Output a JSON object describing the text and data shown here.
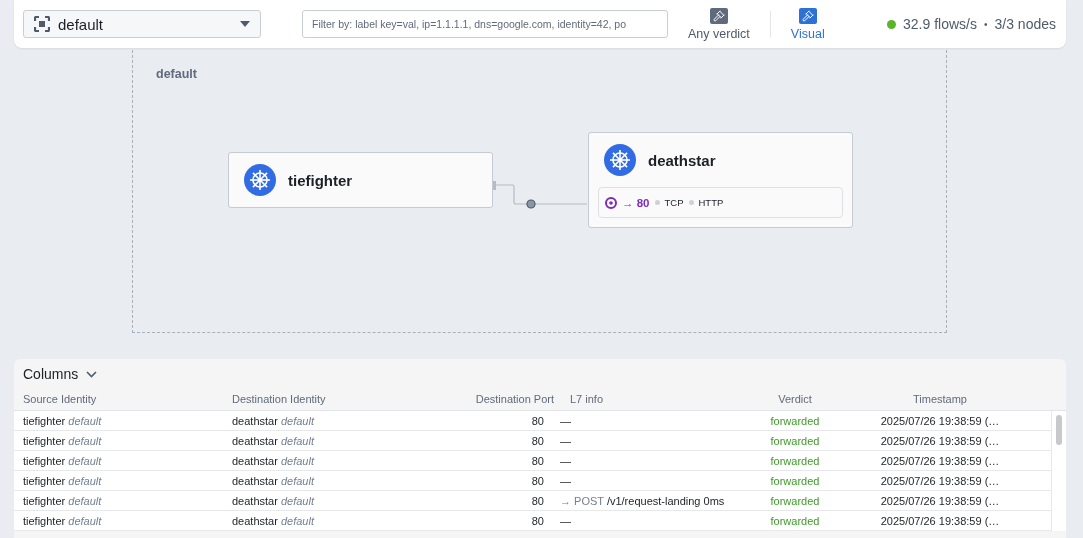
{
  "toolbar": {
    "namespace": "default",
    "filter": {
      "placeholder": "Filter by: label key=val, ip=1.1.1.1, dns=google.com, identity=42, po"
    },
    "view_toggles": [
      {
        "label": "Any verdict",
        "selected": false
      },
      {
        "label": "Visual",
        "selected": true
      }
    ],
    "status": {
      "live": true,
      "flow_rate": "32.9 flows/s",
      "separator": "•",
      "nodes": "3/3 nodes"
    }
  },
  "map": {
    "namespace": "default",
    "services": [
      {
        "name": "tiefighter"
      },
      {
        "name": "deathstar",
        "ports": [
          {
            "arrow": "→",
            "port": "80",
            "protocols": [
              "TCP",
              "HTTP"
            ]
          }
        ]
      }
    ]
  },
  "flows": {
    "columns_button": "Columns",
    "columns": [
      "Source Identity",
      "Destination Identity",
      "Destination Port",
      "L7 info",
      "Verdict",
      "Timestamp"
    ],
    "rows": [
      {
        "source": "tiefighter",
        "source_ns": "default",
        "destination": "deathstar",
        "destination_ns": "default",
        "port": "80",
        "l7": {
          "kind": "none",
          "text": "—"
        },
        "verdict": "forwarded",
        "timestamp": "2025/07/26 19:38:59 (…"
      },
      {
        "source": "tiefighter",
        "source_ns": "default",
        "destination": "deathstar",
        "destination_ns": "default",
        "port": "80",
        "l7": {
          "kind": "none",
          "text": "—"
        },
        "verdict": "forwarded",
        "timestamp": "2025/07/26 19:38:59 (…"
      },
      {
        "source": "tiefighter",
        "source_ns": "default",
        "destination": "deathstar",
        "destination_ns": "default",
        "port": "80",
        "l7": {
          "kind": "none",
          "text": "—"
        },
        "verdict": "forwarded",
        "timestamp": "2025/07/26 19:38:59 (…"
      },
      {
        "source": "tiefighter",
        "source_ns": "default",
        "destination": "deathstar",
        "destination_ns": "default",
        "port": "80",
        "l7": {
          "kind": "none",
          "text": "—"
        },
        "verdict": "forwarded",
        "timestamp": "2025/07/26 19:38:59 (…"
      },
      {
        "source": "tiefighter",
        "source_ns": "default",
        "destination": "deathstar",
        "destination_ns": "default",
        "port": "80",
        "l7": {
          "kind": "http",
          "arrow": "→",
          "method": "POST",
          "path": "/v1/request-landing",
          "latency": "0ms"
        },
        "verdict": "forwarded",
        "timestamp": "2025/07/26 19:38:59 (…"
      },
      {
        "source": "tiefighter",
        "source_ns": "default",
        "destination": "deathstar",
        "destination_ns": "default",
        "port": "80",
        "l7": {
          "kind": "none",
          "text": "—"
        },
        "verdict": "forwarded",
        "timestamp": "2025/07/26 19:38:59 (…"
      }
    ]
  }
}
